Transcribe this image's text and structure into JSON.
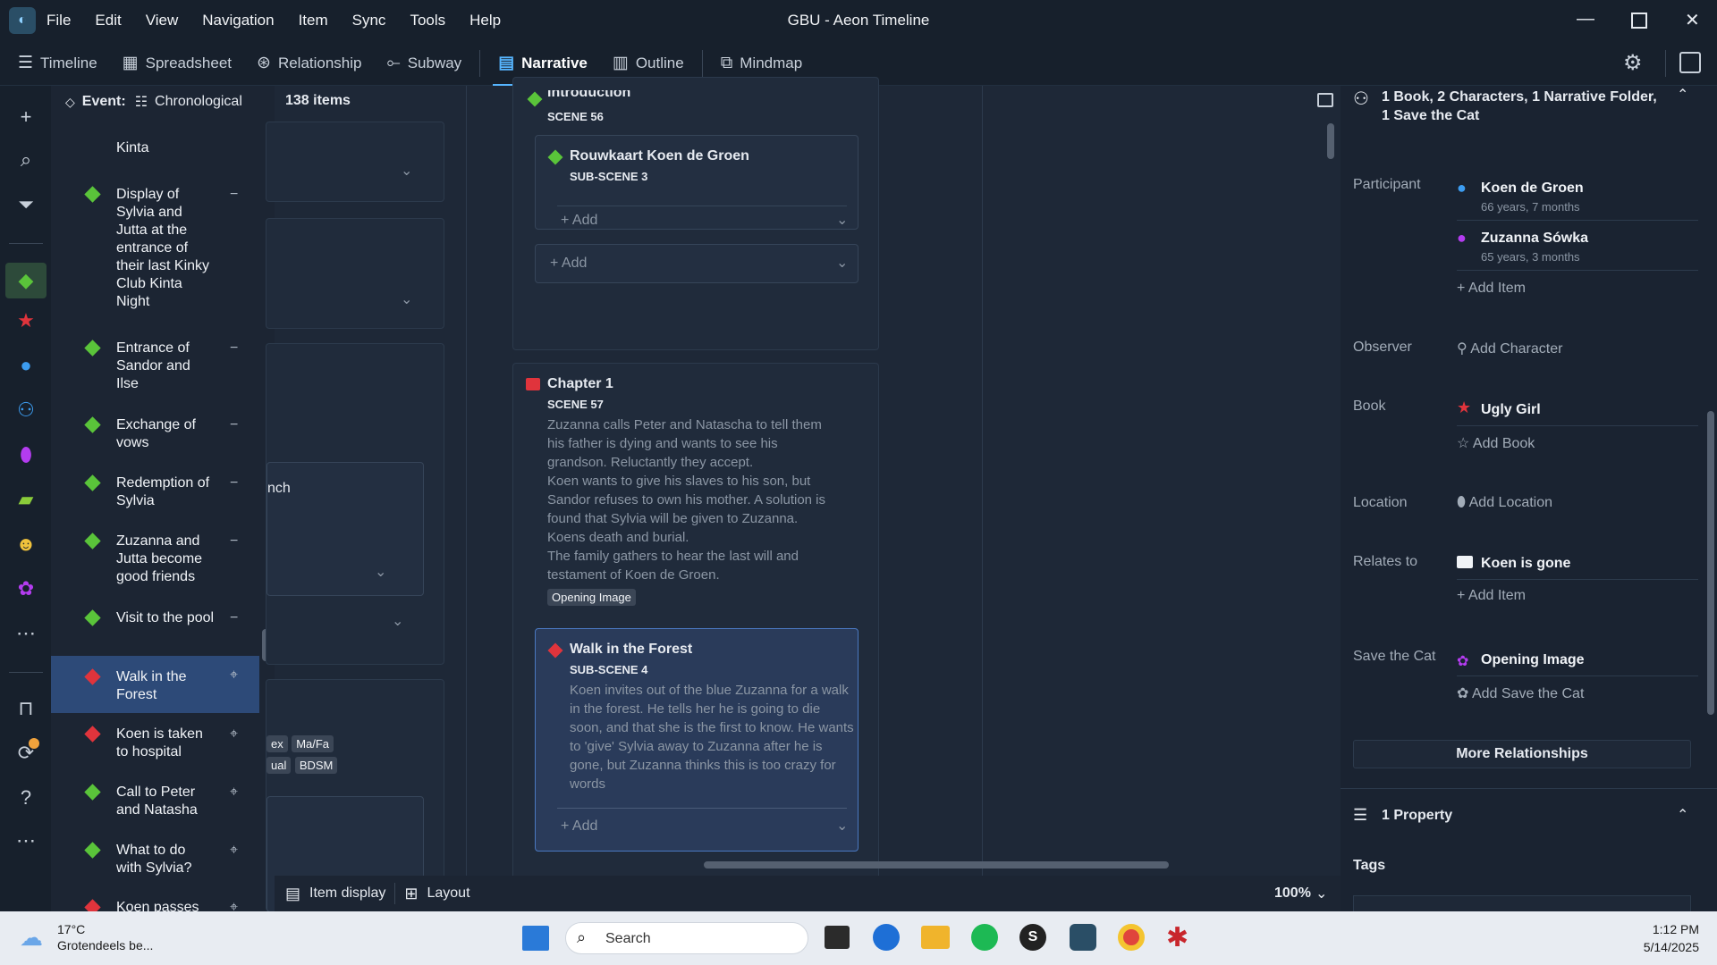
{
  "window": {
    "title": "GBU - Aeon Timeline"
  },
  "menu": [
    "File",
    "Edit",
    "View",
    "Navigation",
    "Item",
    "Sync",
    "Tools",
    "Help"
  ],
  "views": [
    {
      "label": "Timeline",
      "icon": "timeline-icon"
    },
    {
      "label": "Spreadsheet",
      "icon": "spreadsheet-icon"
    },
    {
      "label": "Relationship",
      "icon": "relationship-icon"
    },
    {
      "label": "Subway",
      "icon": "subway-icon"
    },
    {
      "label": "Narrative",
      "icon": "narrative-icon",
      "active": true
    },
    {
      "label": "Outline",
      "icon": "outline-icon"
    },
    {
      "label": "Mindmap",
      "icon": "mindmap-icon"
    }
  ],
  "eventpanel": {
    "title": "Event:",
    "sort": "Chronological",
    "count": "138 items"
  },
  "events": [
    {
      "label": "Kinta",
      "color": "#5ac43a",
      "action": ""
    },
    {
      "label": "Display of Sylvia and Jutta at the entrance of their last Kinky Club Kinta Night",
      "color": "#5ac43a",
      "action": "−"
    },
    {
      "label": "Entrance of Sandor and Ilse",
      "color": "#5ac43a",
      "action": "−"
    },
    {
      "label": "Exchange of vows",
      "color": "#5ac43a",
      "action": "−"
    },
    {
      "label": "Redemption of Sylvia",
      "color": "#5ac43a",
      "action": "−"
    },
    {
      "label": "Zuzanna and Jutta become good friends",
      "color": "#5ac43a",
      "action": "−"
    },
    {
      "label": "Visit to the pool",
      "color": "#5ac43a",
      "action": "−"
    },
    {
      "label": "Walk in the Forest",
      "color": "#e0343c",
      "action": "⌖",
      "selected": true
    },
    {
      "label": "Koen is taken to hospital",
      "color": "#e0343c",
      "action": "⌖"
    },
    {
      "label": "Call to Peter and Natasha",
      "color": "#5ac43a",
      "action": "⌖"
    },
    {
      "label": "What to do with Sylvia?",
      "color": "#5ac43a",
      "action": "⌖"
    },
    {
      "label": "Koen passes",
      "color": "#e0343c",
      "action": "⌖"
    }
  ],
  "leftcol": {
    "partial_text": "nch",
    "tags": [
      "ex",
      "Ma/Fa",
      "ual",
      "BDSM"
    ]
  },
  "narrative": {
    "intro": {
      "title": "Introduction",
      "scene": "SCENE 56"
    },
    "sub1": {
      "title": "Rouwkaart Koen de Groen",
      "scene": "SUB-SCENE 3",
      "add": "Add"
    },
    "add_outer": "Add",
    "chapter": {
      "title": "Chapter 1",
      "scene": "SCENE 57",
      "desc": [
        "Zuzanna calls Peter and Natascha to tell them",
        "his father is dying and wants to see his",
        "grandson. Reluctantly they accept.",
        "Koen wants to give his slaves to his son, but",
        "Sandor refuses to own his mother. A solution is",
        "found that Sylvia will be given to Zuzanna.",
        "Koens death and burial.",
        "The family gathers to hear the last will and",
        "testament of Koen de Groen."
      ],
      "tag": "Opening Image"
    },
    "sub2": {
      "title": "Walk in the Forest",
      "scene": "SUB-SCENE 4",
      "desc": [
        "Koen invites out of the blue Zuzanna for a walk",
        "in the forest. He tells her he is going to die",
        "soon, and that she is the first to know. He wants",
        "to 'give' Sylvia away to Zuzanna after he is",
        "gone, but Zuzanna thinks this is too crazy for",
        "words"
      ],
      "add": "Add"
    }
  },
  "status": {
    "item_display": "Item display",
    "layout": "Layout",
    "zoom": "100%"
  },
  "inspector": {
    "header": "1 Book, 2 Characters, 1 Narrative Folder, 1 Save the Cat",
    "participant_label": "Participant",
    "participants": [
      {
        "name": "Koen de Groen",
        "age": "66 years, 7 months",
        "color": "#3c9cf0"
      },
      {
        "name": "Zuzanna Sówka",
        "age": "65 years, 3 months",
        "color": "#b43cf0"
      }
    ],
    "add_item": "Add Item",
    "observer_label": "Observer",
    "add_character": "Add Character",
    "book_label": "Book",
    "book": "Ugly Girl",
    "add_book": "Add Book",
    "location_label": "Location",
    "add_location": "Add Location",
    "relates_label": "Relates to",
    "relates": "Koen is gone",
    "add_item2": "Add Item",
    "stc_label": "Save the Cat",
    "stc": "Opening Image",
    "add_stc": "Add Save the Cat",
    "more": "More Relationships",
    "property_header": "1 Property",
    "tags_label": "Tags"
  },
  "taskbar": {
    "temp": "17°C",
    "weather": "Grotendeels be...",
    "search": "Search",
    "time": "1:12 PM",
    "date": "5/14/2025"
  }
}
